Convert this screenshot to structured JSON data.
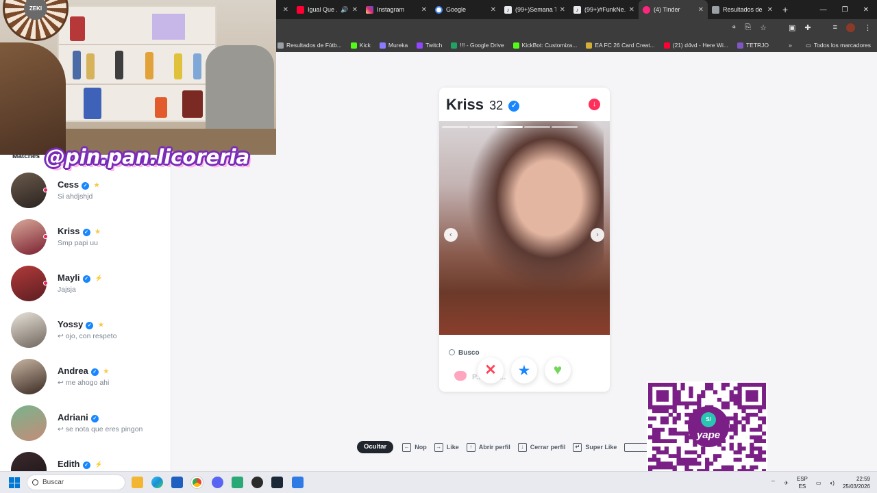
{
  "browser": {
    "tabs": [
      {
        "label": "",
        "fav": "#1f1f1f"
      },
      {
        "label": "Igual Que ...",
        "fav": "#ff0033"
      },
      {
        "label": "Instagram",
        "fav": "#d62976"
      },
      {
        "label": "Google",
        "fav": "#4285f4"
      },
      {
        "label": "(99+)Semana T...",
        "fav": "#111111"
      },
      {
        "label": "(99+)#FunkNe...",
        "fav": "#111111"
      },
      {
        "label": "(4) Tinder",
        "fav": "#fd267a"
      },
      {
        "label": "Resultados de ...",
        "fav": "#9aa0a6"
      }
    ],
    "bookmarks": [
      {
        "label": "Resultados de Fútb...",
        "fav": "#9aa0a6"
      },
      {
        "label": "Kick",
        "fav": "#53fc18"
      },
      {
        "label": "Mureka",
        "fav": "#8a7bff"
      },
      {
        "label": "Twitch",
        "fav": "#9146ff"
      },
      {
        "label": "!!! - Google Drive",
        "fav": "#1fa463"
      },
      {
        "label": "KickBot: Customiza...",
        "fav": "#53fc18"
      },
      {
        "label": "EA FC 26 Card Creat...",
        "fav": "#d4af37"
      },
      {
        "label": "(21) d4vd - Here Wi...",
        "fav": "#ff0033"
      },
      {
        "label": "TETRJO",
        "fav": "#7e57c2"
      }
    ],
    "all_bookmarks": "Todos los marcadores"
  },
  "stream": {
    "handle": "@pin.pan.licoreria",
    "wheel_label": "ZEKI"
  },
  "sidebar": {
    "heading": "Matches",
    "matches": [
      {
        "name": "Cess",
        "msg": "Si ahdjshjd",
        "ext": "★",
        "avatar": [
          "#6b5a4c",
          "#2a2320"
        ],
        "dot": true
      },
      {
        "name": "Kriss",
        "msg": "Smp papi uu",
        "ext": "★",
        "avatar": [
          "#d9a99a",
          "#7a2030"
        ],
        "dot": true
      },
      {
        "name": "Mayli",
        "msg": "Jajsja",
        "ext": "⚡",
        "avatar": [
          "#b23a3a",
          "#5c1e22"
        ],
        "dot": true
      },
      {
        "name": "Yossy",
        "msg": "↩ ojo, con respeto",
        "ext": "★",
        "avatar": [
          "#e8e2da",
          "#6f665c"
        ],
        "dot": false
      },
      {
        "name": "Andrea",
        "msg": "↩ me ahogo ahi",
        "ext": "★",
        "avatar": [
          "#c9b6a4",
          "#3a2a22"
        ],
        "dot": false
      },
      {
        "name": "Adriani",
        "msg": "↩ se nota que eres pingon",
        "ext": "",
        "avatar": [
          "#79b48d",
          "#c48b78"
        ],
        "dot": false
      },
      {
        "name": "Edith",
        "msg": "",
        "ext": "⚡",
        "avatar": [
          "#3b2a2e",
          "#1a1214"
        ],
        "dot": false
      }
    ]
  },
  "profile": {
    "name": "Kriss",
    "age": "32",
    "verified": "✓",
    "looking_for_label": "Busco",
    "looking_for_value": "P... esta...",
    "photo_count": 5,
    "active_photo": 3
  },
  "shortcuts": {
    "hide_label": "Ocultar",
    "items": [
      {
        "key": "←",
        "label": "Nop"
      },
      {
        "key": "→",
        "label": "Like"
      },
      {
        "key": "↑",
        "label": "Abrir perfil"
      },
      {
        "key": "↓",
        "label": "Cerrar perfil"
      },
      {
        "key": "↵",
        "label": "Super Like"
      }
    ]
  },
  "qr": {
    "brand": "yape",
    "currency": "S/"
  },
  "taskbar": {
    "search_placeholder": "Buscar",
    "lang_top": "ESP",
    "lang_bottom": "ES",
    "time": "22:59",
    "date": "25/03/2026"
  },
  "colors": {
    "tinder_accent": "#fd267a",
    "verified_blue": "#1786ff",
    "nope": "#ff4458",
    "super": "#1786ff",
    "like": "#72d65a",
    "yape_purple": "#7a1f85"
  }
}
